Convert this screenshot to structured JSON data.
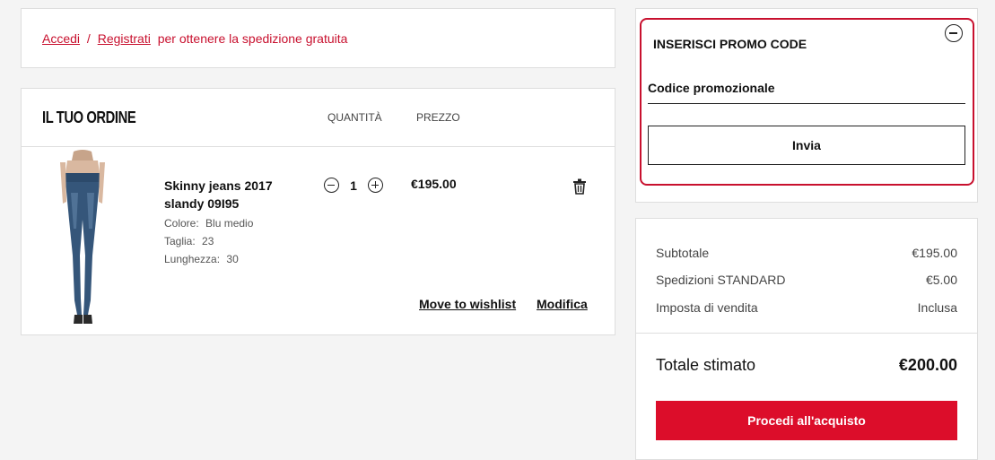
{
  "login_banner": {
    "login_link": "Accedi",
    "separator": "/",
    "register_link": "Registrati",
    "message": "per ottenere la spedizione gratuita"
  },
  "order": {
    "title": "IL TUO ORDINE",
    "col_quantity": "QUANTITÀ",
    "col_price": "PREZZO",
    "item": {
      "name": "Skinny jeans 2017 slandy 09I95",
      "color_label": "Colore:",
      "color_value": "Blu medio",
      "size_label": "Taglia:",
      "size_value": "23",
      "length_label": "Lunghezza:",
      "length_value": "30",
      "quantity": "1",
      "price": "€195.00",
      "wishlist_link": "Move to wishlist",
      "edit_link": "Modifica"
    }
  },
  "promo": {
    "title": "INSERISCI PROMO CODE",
    "input_placeholder": "Codice promozionale",
    "submit_label": "Invia"
  },
  "summary": {
    "subtotal_label": "Subtotale",
    "subtotal_value": "€195.00",
    "shipping_label": "Spedizioni STANDARD",
    "shipping_value": "€5.00",
    "tax_label": "Imposta di vendita",
    "tax_value": "Inclusa",
    "total_label": "Totale stimato",
    "total_value": "€200.00",
    "checkout_label": "Procedi all'acquisto"
  },
  "colors": {
    "accent_red": "#c8102e",
    "checkout_red": "#dc0d2a",
    "background": "#f4f4f4"
  }
}
